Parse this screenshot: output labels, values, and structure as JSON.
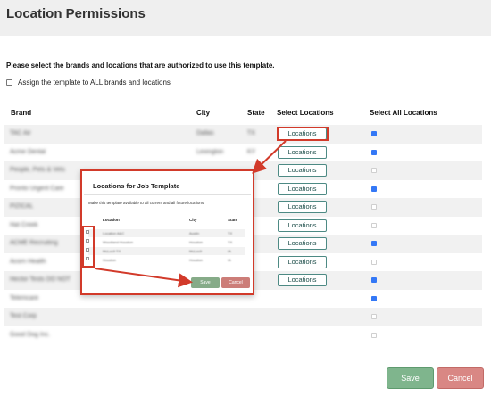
{
  "page_title": "Location Permissions",
  "instruction": "Please select the brands and locations that are authorized to use this template.",
  "assign_all_label": "Assign the template to ALL brands and locations",
  "headers": {
    "brand": "Brand",
    "city": "City",
    "state": "State",
    "select_locations": "Select Locations",
    "select_all_locations": "Select All Locations"
  },
  "rows": [
    {
      "brand": "TAC Air",
      "city": "Dallas",
      "state": "TX",
      "button": "Locations",
      "selected": true
    },
    {
      "brand": "Acme Dental",
      "city": "Lexington",
      "state": "KY",
      "button": "Locations",
      "selected": true
    },
    {
      "brand": "People, Pets & Vets",
      "city": "",
      "state": "",
      "button": "Locations",
      "selected": false
    },
    {
      "brand": "Pronto Urgent Care",
      "city": "",
      "state": "",
      "button": "Locations",
      "selected": true
    },
    {
      "brand": "PIZICAL",
      "city": "",
      "state": "",
      "button": "Locations",
      "selected": false
    },
    {
      "brand": "Hat Creek",
      "city": "",
      "state": "",
      "button": "Locations",
      "selected": false
    },
    {
      "brand": "ACME Recruiting",
      "city": "",
      "state": "",
      "button": "Locations",
      "selected": true
    },
    {
      "brand": "Acorn Health",
      "city": "",
      "state": "",
      "button": "Locations",
      "selected": false
    },
    {
      "brand": "Hector Tests DO NOT",
      "city": "",
      "state": "",
      "button": "Locations",
      "selected": true
    },
    {
      "brand": "Telemcare",
      "city": "",
      "state": "",
      "button": "",
      "selected": true
    },
    {
      "brand": "Test Corp",
      "city": "",
      "state": "",
      "button": "",
      "selected": false
    },
    {
      "brand": "Good Dog Inc.",
      "city": "",
      "state": "",
      "button": "",
      "selected": false
    }
  ],
  "modal": {
    "title": "Locations for Job Template",
    "description": "Make this template available to all current and all future locations.",
    "headers": {
      "location": "Location",
      "city": "City",
      "state": "State"
    },
    "rows": [
      {
        "location": "Location A&C",
        "city": "Austin",
        "state": "TX"
      },
      {
        "location": "Woodland Houston",
        "city": "Houston",
        "state": "TX"
      },
      {
        "location": "McLoc9 TX",
        "city": "McLoc9",
        "state": "IA"
      },
      {
        "location": "Houston",
        "city": "Houston",
        "state": "IA"
      }
    ],
    "save_label": "Save",
    "cancel_label": "Cancel"
  },
  "footer": {
    "save_label": "Save",
    "cancel_label": "Cancel"
  },
  "colors": {
    "accent_teal": "#4d8a84",
    "annotation_red": "#d23a2a",
    "save_green": "#7fb58d",
    "cancel_red": "#d98784",
    "checkbox_blue": "#3478f6"
  }
}
